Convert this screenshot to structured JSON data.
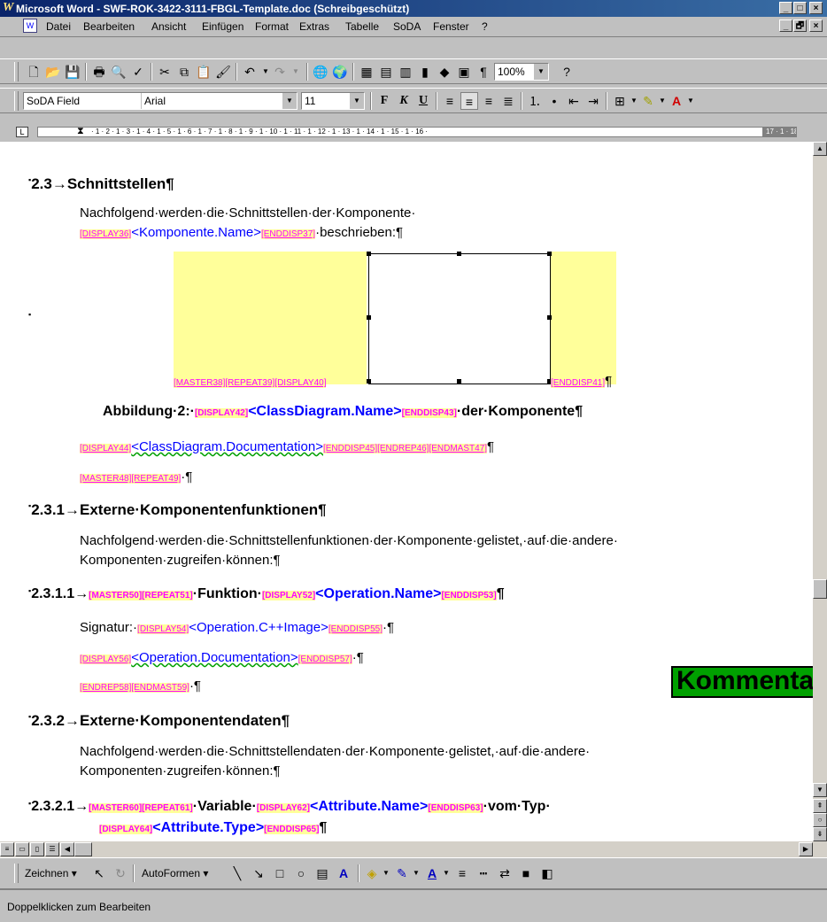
{
  "window": {
    "title": "Microsoft Word - SWF-ROK-3422-3111-FBGL-Template.doc (Schreibgeschützt)",
    "buttons": [
      "_",
      "□",
      "×"
    ],
    "doc_buttons": [
      "_",
      "🗗",
      "×"
    ]
  },
  "menu": {
    "items": [
      "Datei",
      "Bearbeiten",
      "Ansicht",
      "Einfügen",
      "Format",
      "Extras",
      "Tabelle",
      "SoDA",
      "Fenster",
      "?"
    ]
  },
  "standard_toolbar": {
    "zoom": "100%"
  },
  "format_toolbar": {
    "style": "SoDA Field",
    "font": "Arial",
    "size": "11"
  },
  "ruler": {
    "ticks": "· 1 · 2 · 1 · 3 · 1 · 4 · 1 · 5 · 1 · 6 · 1 · 7 · 1 · 8 · 1 · 9 · 1 · 10 · 1 · 11 · 1 · 12 · 1 · 13 · 1 · 14 · 1 · 15 · 1 · 16 ·",
    "end_ticks": "17 · 1 · 18 ·"
  },
  "document": {
    "h1_num": "2.3→",
    "h1_text": "Schnittstellen¶",
    "p1_line1": "Nachfolgend·werden·die·Schnittstellen·der·Komponente·",
    "p1_f1": "[DISPLAY36]",
    "p1_comp": "<Komponente.Name>",
    "p1_f2": "[ENDDISP37]",
    "p1_tail": "·beschrieben:¶",
    "img_fields": "[MASTER38][REPEAT39][DISPLAY40]",
    "img_end": "[ENDDISP41]",
    "img_pilcrow": "¶",
    "cap_label": "Abbildung·2:·",
    "cap_f1": "[DISPLAY42]",
    "cap_name": "<ClassDiagram.Name>",
    "cap_f2": "[ENDDISP43]",
    "cap_tail": "·der·Komponente¶",
    "doc_f1": "[DISPLAY44]",
    "doc_name": "<ClassDiagram.Documentation>",
    "doc_f2": "[ENDDISP45][ENDREP46][ENDMAST47]",
    "doc_pil": "¶",
    "mr_fields": "[MASTER48][REPEAT49]",
    "mr_pil": "·¶",
    "h2_num": "2.3.1→",
    "h2_text": "Externe·Komponentenfunktionen¶",
    "p2_line1": "Nachfolgend·werden·die·Schnittstellenfunktionen·der·Komponente·gelistet,·auf·die·andere·",
    "p2_line2": "Komponenten·zugreifen·können:¶",
    "h3_num": "2.3.1.1→",
    "h3_f1": "[MASTER50][REPEAT51]",
    "h3_mid": "·Funktion·",
    "h3_f2": "[DISPLAY52]",
    "h3_name": "<Operation.Name>",
    "h3_f3": "[ENDDISP53]",
    "h3_pil": "¶",
    "sig_label": "Signatur:·",
    "sig_f1": "[DISPLAY54]",
    "sig_name": "<Operation.C++Image>",
    "sig_f2": "[ENDDISP55]",
    "sig_pil": "·¶",
    "od_f1": "[DISPLAY56]",
    "od_name": "<Operation.Documentation>",
    "od_f2": "[ENDDISP57]",
    "od_pil": "·¶",
    "er_fields": "[ENDREP58][ENDMAST59]",
    "er_pil": "·¶",
    "h4_num": "2.3.2→",
    "h4_text": "Externe·Komponentendaten¶",
    "p3_line1": "Nachfolgend·werden·die·Schnittstellendaten·der·Komponente·gelistet,·auf·die·andere·",
    "p3_line2": "Komponenten·zugreifen·können:¶",
    "h5_num": "2.3.2.1→",
    "h5_f1": "[MASTER60][REPEAT61]",
    "h5_mid": "·Variable·",
    "h5_f2": "[DISPLAY62]",
    "h5_name": "<Attribute.Name>",
    "h5_f3": "[ENDDISP63]",
    "h5_tail": "·vom·Typ·",
    "h5_f4": "[DISPLAY64]",
    "h5_type": "<Attribute.Type>",
    "h5_f5": "[ENDDISP65]",
    "h5_pil": "¶"
  },
  "comment_banner": "Kommentar",
  "draw_toolbar": {
    "draw_label": "Zeichnen",
    "autoshapes_label": "AutoFormen"
  },
  "status": "Doppelklicken zum Bearbeiten",
  "colors": {
    "field_bg": "#ffff9a",
    "field_text": "#ff00ff",
    "link_blue": "#0000ff",
    "title_bar": "#0a246a",
    "comment_green": "#00a000"
  }
}
